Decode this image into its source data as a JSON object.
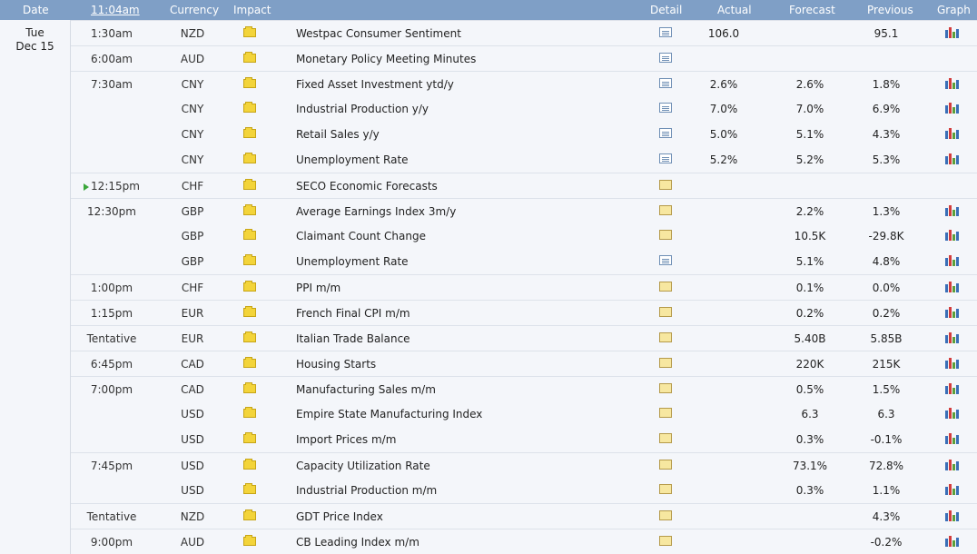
{
  "header": {
    "date": "Date",
    "time": "11:04am",
    "currency": "Currency",
    "impact": "Impact",
    "detail": "Detail",
    "actual": "Actual",
    "forecast": "Forecast",
    "previous": "Previous",
    "graph": "Graph"
  },
  "day": {
    "weekday": "Tue",
    "date": "Dec 15"
  },
  "colors": {
    "header_bg": "#7f9fc6",
    "impact_low": "#f3d43a",
    "now_marker": "#3aa63a"
  },
  "rows": [
    {
      "time": "1:30am",
      "currency": "NZD",
      "event": "Westpac Consumer Sentiment",
      "actual": "106.0",
      "forecast": "",
      "previous": "95.1",
      "detail_icon": "detail-doc-icon",
      "graph": true
    },
    {
      "time": "6:00am",
      "currency": "AUD",
      "event": "Monetary Policy Meeting Minutes",
      "actual": "",
      "forecast": "",
      "previous": "",
      "detail_icon": "detail-doc-icon",
      "graph": false
    },
    {
      "time": "7:30am",
      "currency": "CNY",
      "event": "Fixed Asset Investment ytd/y",
      "actual": "2.6%",
      "forecast": "2.6%",
      "previous": "1.8%",
      "detail_icon": "detail-doc-icon",
      "graph": true
    },
    {
      "time": "",
      "currency": "CNY",
      "event": "Industrial Production y/y",
      "actual": "7.0%",
      "forecast": "7.0%",
      "previous": "6.9%",
      "detail_icon": "detail-doc-icon",
      "graph": true
    },
    {
      "time": "",
      "currency": "CNY",
      "event": "Retail Sales y/y",
      "actual": "5.0%",
      "forecast": "5.1%",
      "previous": "4.3%",
      "detail_icon": "detail-doc-icon",
      "graph": true
    },
    {
      "time": "",
      "currency": "CNY",
      "event": "Unemployment Rate",
      "actual": "5.2%",
      "forecast": "5.2%",
      "previous": "5.3%",
      "detail_icon": "detail-doc-icon",
      "graph": true
    },
    {
      "time": "12:15pm",
      "currency": "CHF",
      "event": "SECO Economic Forecasts",
      "actual": "",
      "forecast": "",
      "previous": "",
      "detail_icon": "detail-folder-icon",
      "graph": false,
      "now": true
    },
    {
      "time": "12:30pm",
      "currency": "GBP",
      "event": "Average Earnings Index 3m/y",
      "actual": "",
      "forecast": "2.2%",
      "previous": "1.3%",
      "detail_icon": "detail-folder-icon",
      "graph": true
    },
    {
      "time": "",
      "currency": "GBP",
      "event": "Claimant Count Change",
      "actual": "",
      "forecast": "10.5K",
      "previous": "-29.8K",
      "detail_icon": "detail-folder-icon",
      "graph": true
    },
    {
      "time": "",
      "currency": "GBP",
      "event": "Unemployment Rate",
      "actual": "",
      "forecast": "5.1%",
      "previous": "4.8%",
      "detail_icon": "detail-doc-icon",
      "graph": true
    },
    {
      "time": "1:00pm",
      "currency": "CHF",
      "event": "PPI m/m",
      "actual": "",
      "forecast": "0.1%",
      "previous": "0.0%",
      "detail_icon": "detail-folder-icon",
      "graph": true
    },
    {
      "time": "1:15pm",
      "currency": "EUR",
      "event": "French Final CPI m/m",
      "actual": "",
      "forecast": "0.2%",
      "previous": "0.2%",
      "detail_icon": "detail-folder-icon",
      "graph": true
    },
    {
      "time": "Tentative",
      "currency": "EUR",
      "event": "Italian Trade Balance",
      "actual": "",
      "forecast": "5.40B",
      "previous": "5.85B",
      "detail_icon": "detail-folder-icon",
      "graph": true
    },
    {
      "time": "6:45pm",
      "currency": "CAD",
      "event": "Housing Starts",
      "actual": "",
      "forecast": "220K",
      "previous": "215K",
      "detail_icon": "detail-folder-icon",
      "graph": true
    },
    {
      "time": "7:00pm",
      "currency": "CAD",
      "event": "Manufacturing Sales m/m",
      "actual": "",
      "forecast": "0.5%",
      "previous": "1.5%",
      "detail_icon": "detail-folder-icon",
      "graph": true
    },
    {
      "time": "",
      "currency": "USD",
      "event": "Empire State Manufacturing Index",
      "actual": "",
      "forecast": "6.3",
      "previous": "6.3",
      "detail_icon": "detail-folder-icon",
      "graph": true
    },
    {
      "time": "",
      "currency": "USD",
      "event": "Import Prices m/m",
      "actual": "",
      "forecast": "0.3%",
      "previous": "-0.1%",
      "detail_icon": "detail-folder-icon",
      "graph": true
    },
    {
      "time": "7:45pm",
      "currency": "USD",
      "event": "Capacity Utilization Rate",
      "actual": "",
      "forecast": "73.1%",
      "previous": "72.8%",
      "detail_icon": "detail-folder-icon",
      "graph": true
    },
    {
      "time": "",
      "currency": "USD",
      "event": "Industrial Production m/m",
      "actual": "",
      "forecast": "0.3%",
      "previous": "1.1%",
      "detail_icon": "detail-folder-icon",
      "graph": true
    },
    {
      "time": "Tentative",
      "currency": "NZD",
      "event": "GDT Price Index",
      "actual": "",
      "forecast": "",
      "previous": "4.3%",
      "detail_icon": "detail-folder-icon",
      "graph": true
    },
    {
      "time": "9:00pm",
      "currency": "AUD",
      "event": "CB Leading Index m/m",
      "actual": "",
      "forecast": "",
      "previous": "-0.2%",
      "detail_icon": "detail-folder-icon",
      "graph": true
    }
  ]
}
